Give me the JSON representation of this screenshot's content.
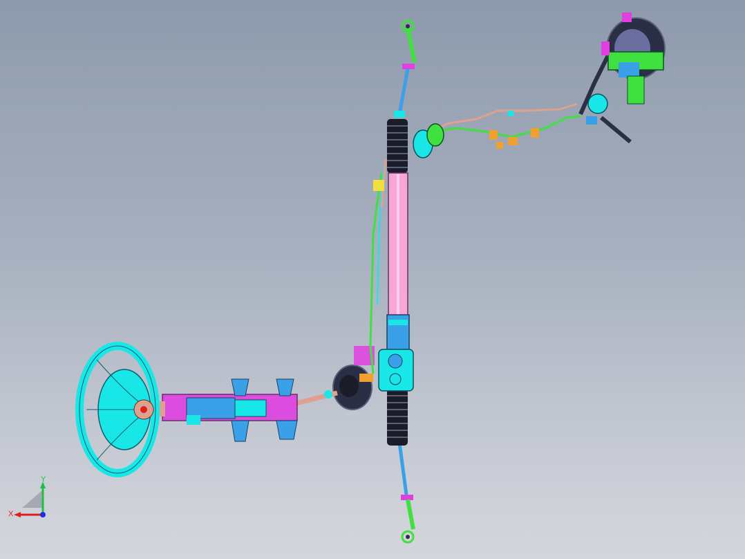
{
  "viewport": {
    "background_top": "#8e9aac",
    "background_bottom": "#d4d6dc"
  },
  "model": {
    "description_icon": "steering-system-3d-model",
    "colors": {
      "cyan": "#19e6e6",
      "pink": "#f5a8d8",
      "magenta": "#e040e0",
      "green": "#40e040",
      "blue": "#3aa0e8",
      "dark": "#2a2f45",
      "orange": "#f0a030",
      "copper": "#e0a090"
    }
  },
  "triad": {
    "x_label": "X",
    "y_label": "Y",
    "x_color": "#e02020",
    "y_color": "#20c040",
    "z_color": "#2030e0"
  }
}
